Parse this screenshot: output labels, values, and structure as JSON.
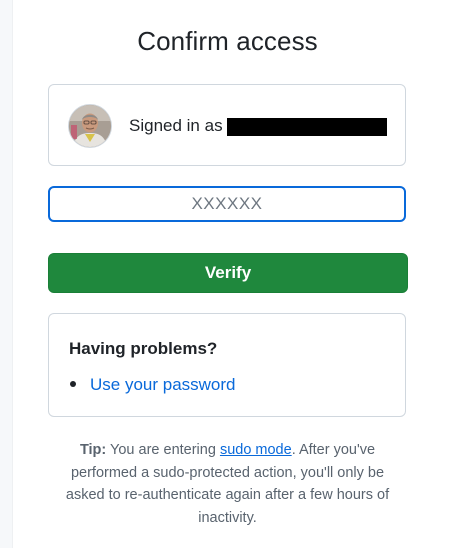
{
  "page": {
    "title": "Confirm access"
  },
  "account": {
    "signed_in_label": "Signed in as",
    "username_redacted": true
  },
  "otp": {
    "placeholder": "XXXXXX",
    "value": ""
  },
  "actions": {
    "verify_label": "Verify"
  },
  "help": {
    "heading": "Having problems?",
    "options": [
      {
        "label": "Use your password"
      }
    ]
  },
  "tip": {
    "label": "Tip:",
    "text_before_link": " You are entering ",
    "link_text": "sudo mode",
    "text_after_link": ". After you've performed a sudo-protected action, you'll only be asked to re-authenticate again after a few hours of inactivity."
  },
  "colors": {
    "primary_button": "#1f883d",
    "link": "#0969da",
    "focus_border": "#0969da",
    "card_border": "#d0d7de",
    "redaction": "#000000"
  },
  "icons": {
    "avatar": "user-avatar"
  }
}
